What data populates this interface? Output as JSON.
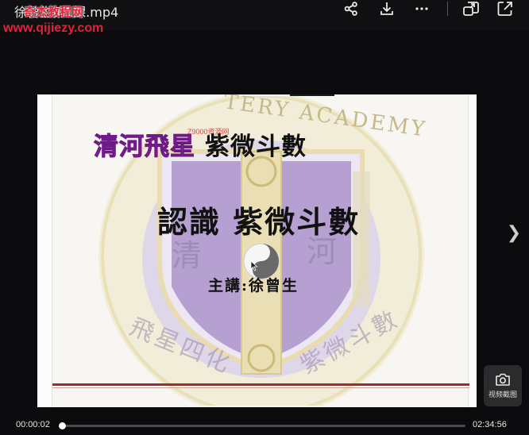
{
  "header": {
    "file_title": "徐曾生第1課.mp4",
    "watermark_name": "奇杰教程网",
    "watermark_url": "www.qijiezy.com"
  },
  "toolbar": {
    "icons": [
      "share-icon",
      "download-icon",
      "more-icon",
      "picture-in-picture-icon",
      "open-external-icon"
    ]
  },
  "slide": {
    "title_part1": "清河飛星",
    "title_part2": "紫微斗數",
    "main_title": "認識 紫微斗數",
    "lecturer": "主講:徐曾生",
    "emblem_text_top": "TERY ACADEMY",
    "emblem_text_left": "清",
    "emblem_text_right": "河",
    "emblem_text_bottom_left": "飛星四化",
    "emblem_text_bottom_right": "紫微斗數",
    "inner_watermark": "Z9000资源网"
  },
  "player": {
    "next_label": "❯",
    "screenshot_label": "视频截图",
    "current_time": "00:00:02",
    "duration": "02:34:56",
    "progress": 0.0002,
    "colors": {
      "accent": "#ffffff",
      "track": "#4a4a4c",
      "background": "#0b0b0d"
    }
  }
}
